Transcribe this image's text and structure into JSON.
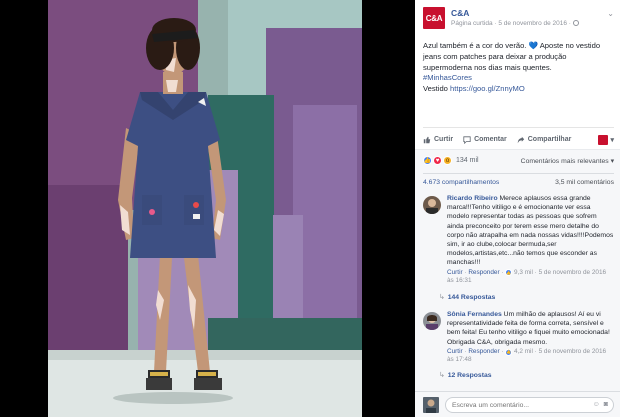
{
  "post": {
    "page_name": "C&A",
    "logo_text": "C&A",
    "meta": "Página curtida · 5 de novembro de 2016 ·",
    "text_line1": "Azul também é a cor do verão. ",
    "heart": "💙",
    "text_line1b": " Aposte no vestido jeans com patches para deixar a produção supermoderna nos dias mais quentes.",
    "hashtag": "#MinhasCores",
    "vestido_label": "Vestido ",
    "vestido_link": "https://goo.gl/ZnnyMO"
  },
  "actions": {
    "like": "Curtir",
    "comment": "Comentar",
    "share": "Compartilhar"
  },
  "reactions": {
    "count": "134 mil",
    "sort_label": "Comentários mais relevantes ▾"
  },
  "counts": {
    "shares": "4.673 compartilhamentos",
    "comments": "3,5 mil comentários"
  },
  "comments": [
    {
      "name": "Ricardo Ribeiro",
      "text": " Merece aplausos essa grande marca!!!Tenho vitiligo e é emocionante ver essa modelo representar todas as pessoas que sofrem ainda preconceito por terem esse mero detalhe do corpo não atrapalha em nada nossas vidas!!!!Podemos sim, ir ao clube,colocar bermuda,ser modelos,artistas,etc...não temos que esconder as manchas!!!",
      "like": "Curtir",
      "reply": "Responder",
      "reaction_count": "9,3 mil",
      "date": "5 de novembro de 2016 às 16:31",
      "replies": "144 Respostas"
    },
    {
      "name": "Sônia Fernandes",
      "text": " Um milhão de aplausos! Aí eu vi representatividade feita de forma correta, sensível e bem feita! Eu tenho vitiligo e fiquei muito emocionada! Obrigada C&A, obrigada mesmo.",
      "like": "Curtir",
      "reply": "Responder",
      "reaction_count": "4,2 mil",
      "date": "5 de novembro de 2016 às 17:48",
      "replies": "12 Respostas"
    }
  ],
  "compose": {
    "placeholder": "Escreva um comentário..."
  },
  "colors": {
    "brand": "#c8102e",
    "link": "#365899",
    "dress": "#3d4f83"
  }
}
